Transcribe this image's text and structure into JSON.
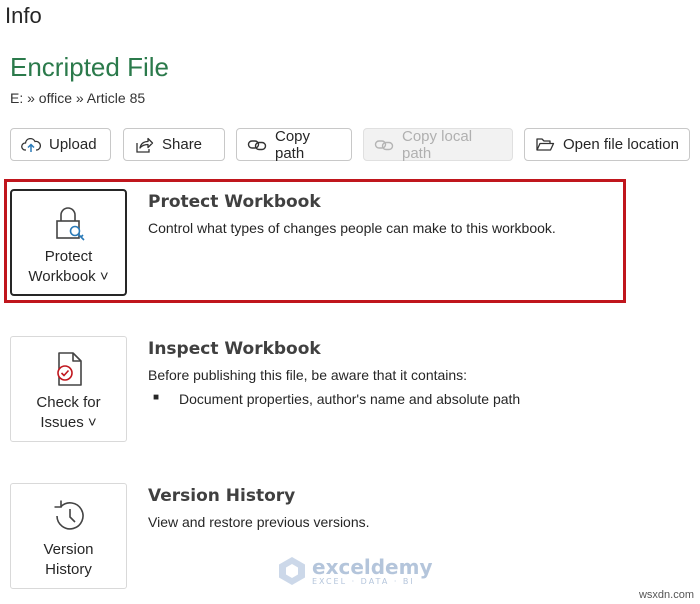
{
  "page": {
    "title": "Info"
  },
  "file": {
    "name": "Encripted File",
    "path": "E: » office » Article 85"
  },
  "toolbar": {
    "upload_label": "Upload",
    "share_label": "Share",
    "copy_path_label": "Copy path",
    "copy_local_path_label": "Copy local path",
    "open_location_label": "Open file location"
  },
  "protect": {
    "button_line1": "Protect",
    "button_line2": "Workbook ˅",
    "title": "Protect Workbook",
    "description": "Control what types of changes people can make to this workbook."
  },
  "inspect": {
    "button_line1": "Check for",
    "button_line2": "Issues ˅",
    "title": "Inspect Workbook",
    "description": "Before publishing this file, be aware that it contains:",
    "items": [
      "Document properties, author's name and absolute path"
    ]
  },
  "history": {
    "button_line1": "Version",
    "button_line2": "History",
    "title": "Version History",
    "description": "View and restore previous versions."
  },
  "watermark": {
    "title": "exceldemy",
    "subtitle": "EXCEL · DATA · BI"
  },
  "corner": {
    "text": "wsxdn.com"
  },
  "colors": {
    "file_name": "#2b7a4b",
    "highlight": "#c0161d",
    "selected_border": "#262626"
  }
}
